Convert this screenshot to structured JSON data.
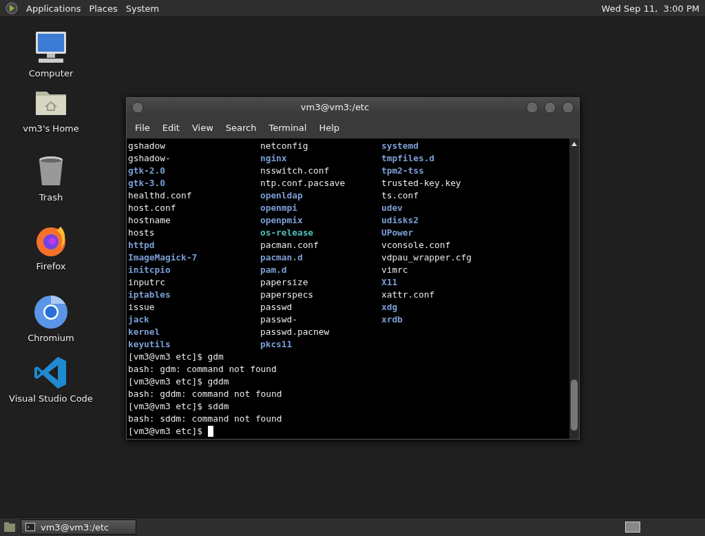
{
  "top_panel": {
    "menus": [
      "Applications",
      "Places",
      "System"
    ],
    "clock": "Wed Sep 11,  3:00 PM"
  },
  "desktop_icons": [
    {
      "label": "Computer",
      "kind": "computer"
    },
    {
      "label": "vm3's Home",
      "kind": "home"
    },
    {
      "label": "Trash",
      "kind": "trash"
    },
    {
      "label": "Firefox",
      "kind": "firefox"
    },
    {
      "label": "Chromium",
      "kind": "chromium"
    },
    {
      "label": "Visual Studio Code",
      "kind": "vscode"
    }
  ],
  "terminal": {
    "title": "vm3@vm3:/etc",
    "menu": [
      "File",
      "Edit",
      "View",
      "Search",
      "Terminal",
      "Help"
    ],
    "listing": [
      [
        {
          "name": "gshadow",
          "kind": "file"
        },
        {
          "name": "netconfig",
          "kind": "file"
        },
        {
          "name": "systemd",
          "kind": "dir"
        }
      ],
      [
        {
          "name": "gshadow-",
          "kind": "file"
        },
        {
          "name": "nginx",
          "kind": "dir"
        },
        {
          "name": "tmpfiles.d",
          "kind": "dir"
        }
      ],
      [
        {
          "name": "gtk-2.0",
          "kind": "dir"
        },
        {
          "name": "nsswitch.conf",
          "kind": "file"
        },
        {
          "name": "tpm2-tss",
          "kind": "dir"
        }
      ],
      [
        {
          "name": "gtk-3.0",
          "kind": "dir"
        },
        {
          "name": "ntp.conf.pacsave",
          "kind": "file"
        },
        {
          "name": "trusted-key.key",
          "kind": "file"
        }
      ],
      [
        {
          "name": "healthd.conf",
          "kind": "file"
        },
        {
          "name": "openldap",
          "kind": "dir"
        },
        {
          "name": "ts.conf",
          "kind": "file"
        }
      ],
      [
        {
          "name": "host.conf",
          "kind": "file"
        },
        {
          "name": "openmpi",
          "kind": "dir"
        },
        {
          "name": "udev",
          "kind": "dir"
        }
      ],
      [
        {
          "name": "hostname",
          "kind": "file"
        },
        {
          "name": "openpmix",
          "kind": "dir"
        },
        {
          "name": "udisks2",
          "kind": "dir"
        }
      ],
      [
        {
          "name": "hosts",
          "kind": "file"
        },
        {
          "name": "os-release",
          "kind": "link"
        },
        {
          "name": "UPower",
          "kind": "dir"
        }
      ],
      [
        {
          "name": "httpd",
          "kind": "dir"
        },
        {
          "name": "pacman.conf",
          "kind": "file"
        },
        {
          "name": "vconsole.conf",
          "kind": "file"
        }
      ],
      [
        {
          "name": "ImageMagick-7",
          "kind": "dir"
        },
        {
          "name": "pacman.d",
          "kind": "dir"
        },
        {
          "name": "vdpau_wrapper.cfg",
          "kind": "file"
        }
      ],
      [
        {
          "name": "initcpio",
          "kind": "dir"
        },
        {
          "name": "pam.d",
          "kind": "dir"
        },
        {
          "name": "vimrc",
          "kind": "file"
        }
      ],
      [
        {
          "name": "inputrc",
          "kind": "file"
        },
        {
          "name": "papersize",
          "kind": "file"
        },
        {
          "name": "X11",
          "kind": "dir"
        }
      ],
      [
        {
          "name": "iptables",
          "kind": "dir"
        },
        {
          "name": "paperspecs",
          "kind": "file"
        },
        {
          "name": "xattr.conf",
          "kind": "file"
        }
      ],
      [
        {
          "name": "issue",
          "kind": "file"
        },
        {
          "name": "passwd",
          "kind": "file"
        },
        {
          "name": "xdg",
          "kind": "dir"
        }
      ],
      [
        {
          "name": "jack",
          "kind": "dir"
        },
        {
          "name": "passwd-",
          "kind": "file"
        },
        {
          "name": "xrdb",
          "kind": "dir"
        }
      ],
      [
        {
          "name": "kernel",
          "kind": "dir"
        },
        {
          "name": "passwd.pacnew",
          "kind": "file"
        }
      ],
      [
        {
          "name": "keyutils",
          "kind": "dir"
        },
        {
          "name": "pkcs11",
          "kind": "dir"
        }
      ]
    ],
    "output": [
      "[vm3@vm3 etc]$ gdm",
      "bash: gdm: command not found",
      "[vm3@vm3 etc]$ gddm",
      "bash: gddm: command not found",
      "[vm3@vm3 etc]$ sddm",
      "bash: sddm: command not found"
    ],
    "prompt": "[vm3@vm3 etc]$"
  },
  "taskbar": {
    "tasks": [
      {
        "label": "vm3@vm3:/etc",
        "selected": true
      }
    ]
  }
}
